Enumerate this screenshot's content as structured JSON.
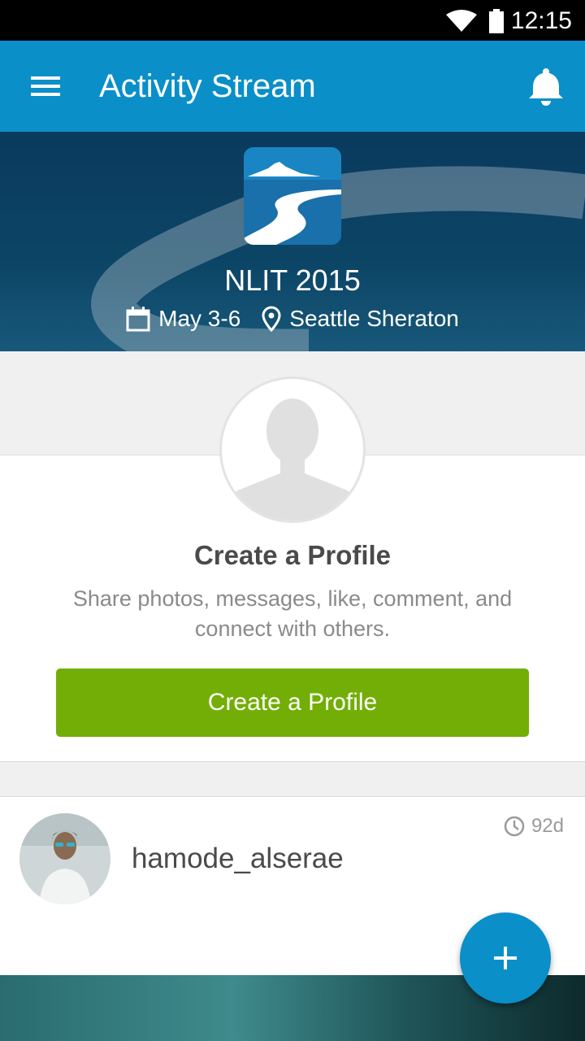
{
  "status_bar": {
    "time": "12:15",
    "wifi_icon": "wifi-icon",
    "battery_icon": "battery-icon"
  },
  "app_bar": {
    "title": "Activity Stream",
    "menu_icon": "hamburger-menu-icon",
    "notification_icon": "bell-icon"
  },
  "event": {
    "name": "NLIT 2015",
    "dates": "May 3-6",
    "location": "Seattle Sheraton",
    "calendar_icon": "calendar-icon",
    "location_icon": "map-pin-icon"
  },
  "profile_prompt": {
    "heading": "Create a Profile",
    "description": "Share photos, messages, like, comment, and connect with others.",
    "button_label": "Create a Profile",
    "placeholder_icon": "person-silhouette-icon"
  },
  "post": {
    "username": "hamode_alserae",
    "age": "92d",
    "clock_icon": "clock-icon"
  },
  "fab": {
    "icon": "plus-icon"
  },
  "colors": {
    "primary": "#0a8fc8",
    "button_green": "#72ae06",
    "text_dark": "#4a4a4a",
    "text_muted": "#8a8a8a"
  }
}
